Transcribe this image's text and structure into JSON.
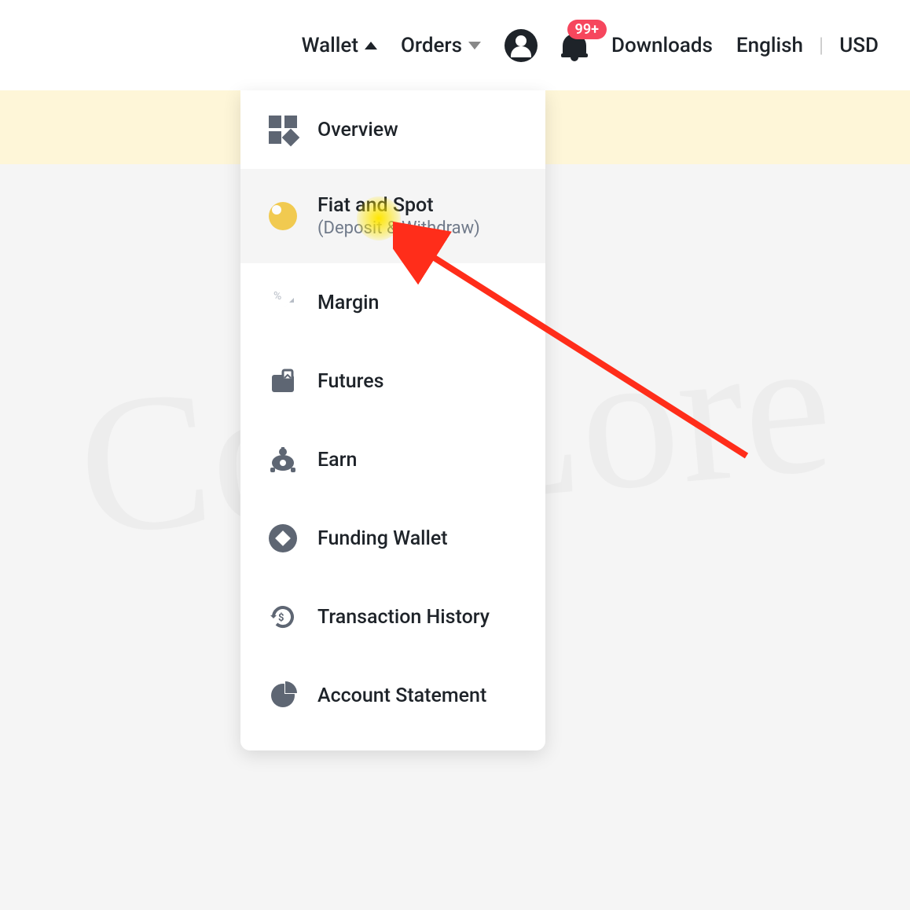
{
  "header": {
    "wallet": "Wallet",
    "orders": "Orders",
    "badge": "99+",
    "downloads": "Downloads",
    "language": "English",
    "currency": "USD"
  },
  "dropdown": {
    "items": [
      {
        "label": "Overview",
        "sublabel": ""
      },
      {
        "label": "Fiat and Spot",
        "sublabel": "(Deposit & Withdraw)"
      },
      {
        "label": "Margin",
        "sublabel": ""
      },
      {
        "label": "Futures",
        "sublabel": ""
      },
      {
        "label": "Earn",
        "sublabel": ""
      },
      {
        "label": "Funding Wallet",
        "sublabel": ""
      },
      {
        "label": "Transaction History",
        "sublabel": ""
      },
      {
        "label": "Account Statement",
        "sublabel": ""
      }
    ]
  },
  "watermark": "CoinLore"
}
